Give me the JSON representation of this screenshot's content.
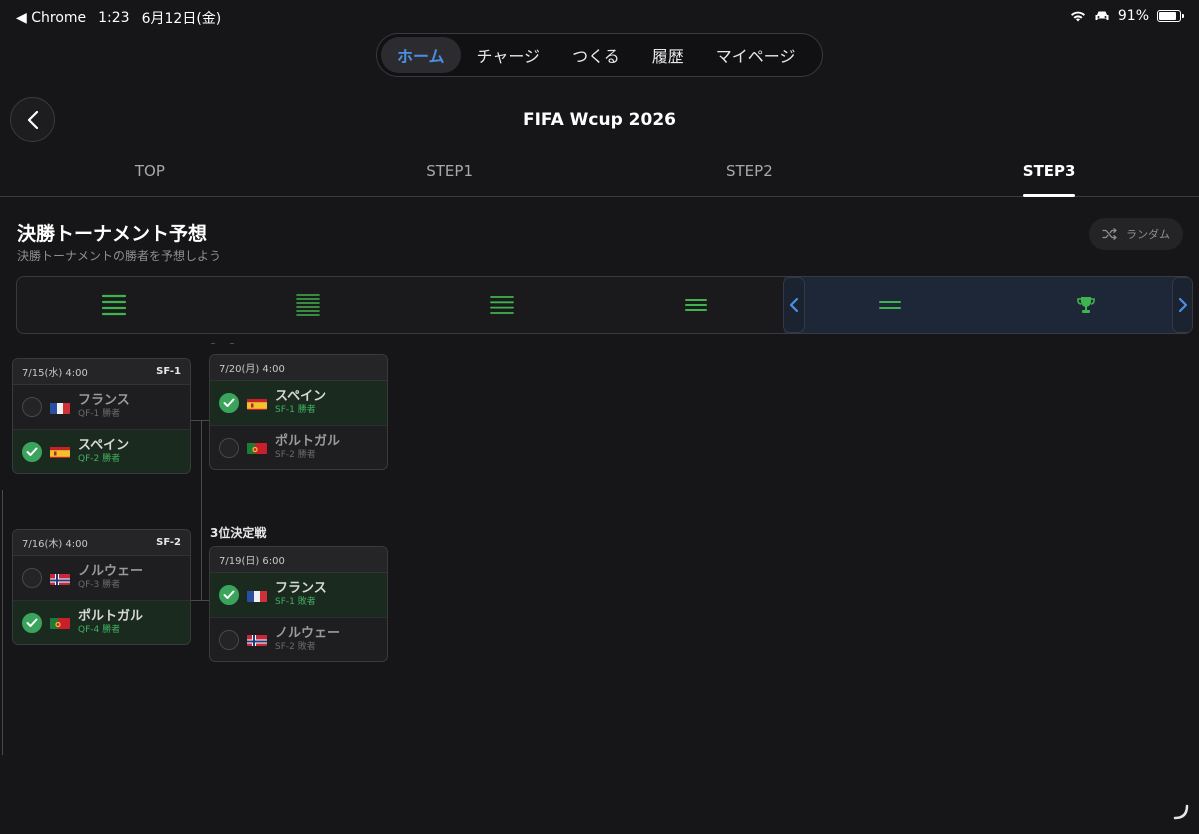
{
  "status": {
    "back_app": "Chrome",
    "time": "1:23",
    "date": "6月12日(金)",
    "battery": "91%",
    "battery_level": 0.91
  },
  "topnav": {
    "items": [
      {
        "label": "ホーム",
        "active": true
      },
      {
        "label": "チャージ"
      },
      {
        "label": "つくる"
      },
      {
        "label": "履歴"
      },
      {
        "label": "マイページ"
      }
    ]
  },
  "header": {
    "title": "FIFA Wcup 2026"
  },
  "tabs": [
    "TOP",
    "STEP1",
    "STEP2",
    "STEP3"
  ],
  "active_tab": "STEP3",
  "section": {
    "title": "決勝トーナメント予想",
    "subtitle": "決勝トーナメントの勝者を予想しよう",
    "random_label": "ランダム"
  },
  "colors": {
    "accent": "#4a90e2",
    "win_green": "#3aa35c",
    "round_icon": "#3fb34f"
  },
  "semifinals": [
    {
      "datetime": "7/15(水) 4:00",
      "code": "SF-1",
      "teams": [
        {
          "name": "フランス",
          "sub": "QF-1 勝者",
          "flag": "france",
          "selected": false
        },
        {
          "name": "スペイン",
          "sub": "QF-2 勝者",
          "flag": "spain",
          "selected": true
        }
      ]
    },
    {
      "datetime": "7/16(木) 4:00",
      "code": "SF-2",
      "teams": [
        {
          "name": "ノルウェー",
          "sub": "QF-3 勝者",
          "flag": "norway",
          "selected": false
        },
        {
          "name": "ポルトガル",
          "sub": "QF-4 勝者",
          "flag": "portugal",
          "selected": true
        }
      ]
    }
  ],
  "final": {
    "datetime": "7/20(月) 4:00",
    "teams": [
      {
        "name": "スペイン",
        "sub": "SF-1 勝者",
        "flag": "spain",
        "selected": true
      },
      {
        "name": "ポルトガル",
        "sub": "SF-2 勝者",
        "flag": "portugal",
        "selected": false
      }
    ]
  },
  "third_place": {
    "label": "3位決定戦",
    "datetime": "7/19(日) 6:00",
    "teams": [
      {
        "name": "フランス",
        "sub": "SF-1 敗者",
        "flag": "france",
        "selected": true
      },
      {
        "name": "ノルウェー",
        "sub": "SF-2 敗者",
        "flag": "norway",
        "selected": false
      }
    ]
  }
}
